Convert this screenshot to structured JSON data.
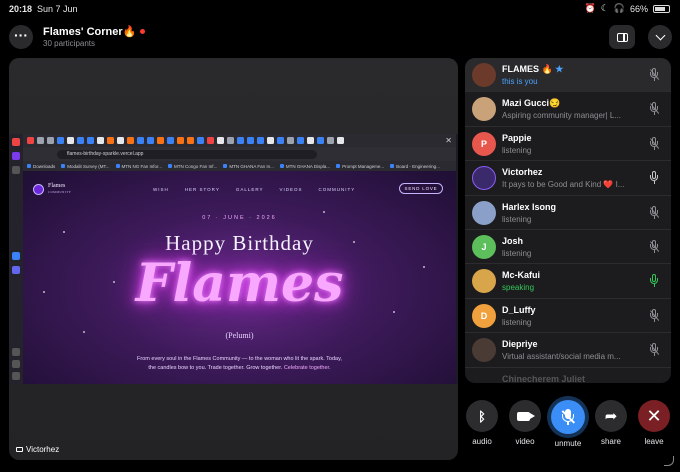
{
  "status_bar": {
    "time": "20:18",
    "date": "Sun 7 Jun",
    "battery": "66%"
  },
  "header": {
    "title": "Flames' Corner🔥",
    "subtitle": "30 participants"
  },
  "video": {
    "label": "Victorhez"
  },
  "shared_screen": {
    "url": "flames-birthday-sparkle.vercel.app",
    "bookmarks": [
      "Downloads",
      "Modalit Survey (MT...",
      "MTN NG Fan Infor...",
      "MTN Congo Fan Inf...",
      "MTN GHANA Fan In...",
      "MTN GHANA Displa...",
      "Prompt Manageme...",
      "Board - Engineering..."
    ],
    "site": {
      "brand": "Flames",
      "brand_sub": "COMMUNITY",
      "nav": [
        "WISH",
        "HER STORY",
        "GALLERY",
        "VIDEOS",
        "COMMUNITY"
      ],
      "cta": "SEND LOVE",
      "date": "07 · JUNE · 2026",
      "heading": "Happy Birthday",
      "name": "Flames",
      "nickname": "(Pelumi)",
      "blurb_1": "From every soul in the Flames Community — to the woman who lit the spark. Today,",
      "blurb_2": "the candles bow to you. Trade together. Grow together.",
      "blurb_hl": "Celebrate together."
    }
  },
  "participants": [
    {
      "name": "FLAMES 🔥",
      "status": "this is you",
      "status_color": "blue",
      "avatar_color": "#6b3a2a",
      "initial": "",
      "mic": "muted",
      "verified": true
    },
    {
      "name": "Mazi Gucci😏",
      "status": "Aspiring community manager| L...",
      "status_color": "gray",
      "avatar_color": "#c9a27a",
      "initial": "",
      "mic": "muted"
    },
    {
      "name": "Pappie",
      "status": "listening",
      "status_color": "gray",
      "avatar_color": "#e8574e",
      "initial": "P",
      "mic": "muted"
    },
    {
      "name": "Victorhez",
      "status": "It pays to be Good and Kind ❤️ I...",
      "status_color": "gray",
      "avatar_color": "#3b2a6b",
      "initial": "",
      "mic": "open"
    },
    {
      "name": "Harlex Isong",
      "status": "listening",
      "status_color": "gray",
      "avatar_color": "#8aa0c8",
      "initial": "",
      "mic": "muted"
    },
    {
      "name": "Josh",
      "status": "listening",
      "status_color": "gray",
      "avatar_color": "#5cbf5c",
      "initial": "J",
      "mic": "muted"
    },
    {
      "name": "Mc-Kafui",
      "status": "speaking",
      "status_color": "green",
      "avatar_color": "#d9a54a",
      "initial": "",
      "mic": "green"
    },
    {
      "name": "D_Luffy",
      "status": "listening",
      "status_color": "gray",
      "avatar_color": "#f0a03c",
      "initial": "D",
      "mic": "muted"
    },
    {
      "name": "Diepriye",
      "status": "Virtual assistant/social media m...",
      "status_color": "gray",
      "avatar_color": "#4a3b35",
      "initial": "",
      "mic": "muted"
    }
  ],
  "participants_cutoff": "Chinecherem Juliet",
  "controls": [
    {
      "label": "audio"
    },
    {
      "label": "video"
    },
    {
      "label": "unmute"
    },
    {
      "label": "share"
    },
    {
      "label": "leave"
    }
  ],
  "colors": {
    "accent": "#3a8ef6",
    "leave": "#7a1f24",
    "speaking": "#34c759",
    "you": "#4aa3ff"
  }
}
